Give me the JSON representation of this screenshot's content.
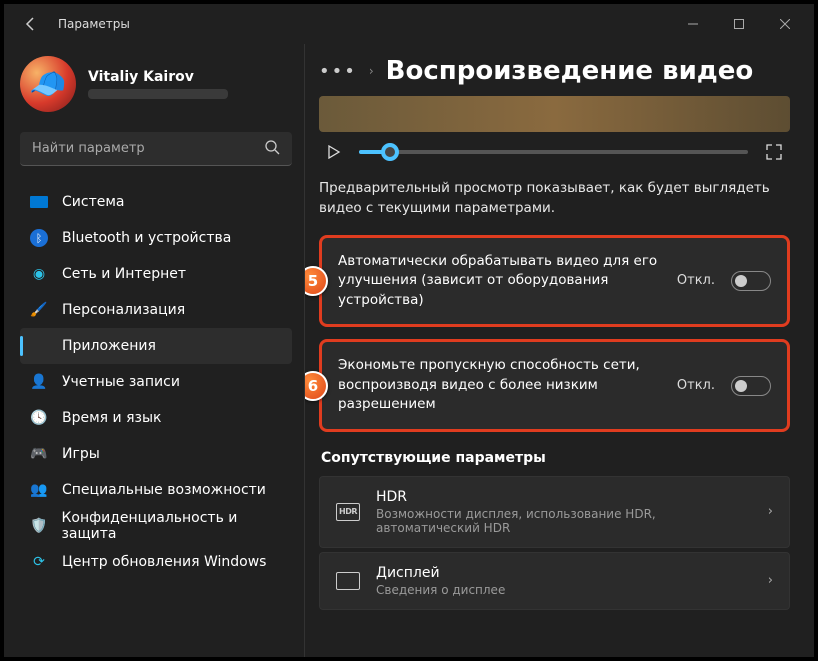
{
  "window": {
    "title": "Параметры"
  },
  "user": {
    "name": "Vitaliy Kairov"
  },
  "search": {
    "placeholder": "Найти параметр"
  },
  "sidebar": {
    "items": [
      {
        "label": "Система"
      },
      {
        "label": "Bluetooth и устройства"
      },
      {
        "label": "Сеть и Интернет"
      },
      {
        "label": "Персонализация"
      },
      {
        "label": "Приложения"
      },
      {
        "label": "Учетные записи"
      },
      {
        "label": "Время и язык"
      },
      {
        "label": "Игры"
      },
      {
        "label": "Специальные возможности"
      },
      {
        "label": "Конфиденциальность и защита"
      },
      {
        "label": "Центр обновления Windows"
      }
    ],
    "active_index": 4
  },
  "page": {
    "title": "Воспроизведение видео",
    "preview_desc": "Предварительный просмотр показывает, как будет выглядеть видео с текущими параметрами.",
    "toggles": [
      {
        "badge": "5",
        "label": "Автоматически обрабатывать видео для его улучшения (зависит от оборудования устройства)",
        "state": "Откл."
      },
      {
        "badge": "6",
        "label": "Экономьте пропускную способность сети, воспроизводя видео с более низким разрешением",
        "state": "Откл."
      }
    ],
    "related_heading": "Сопутствующие параметры",
    "related": [
      {
        "icon": "HDR",
        "title": "HDR",
        "sub": "Возможности дисплея, использование HDR, автоматический HDR"
      },
      {
        "icon": "▭",
        "title": "Дисплей",
        "sub": "Сведения о дисплее"
      }
    ]
  }
}
